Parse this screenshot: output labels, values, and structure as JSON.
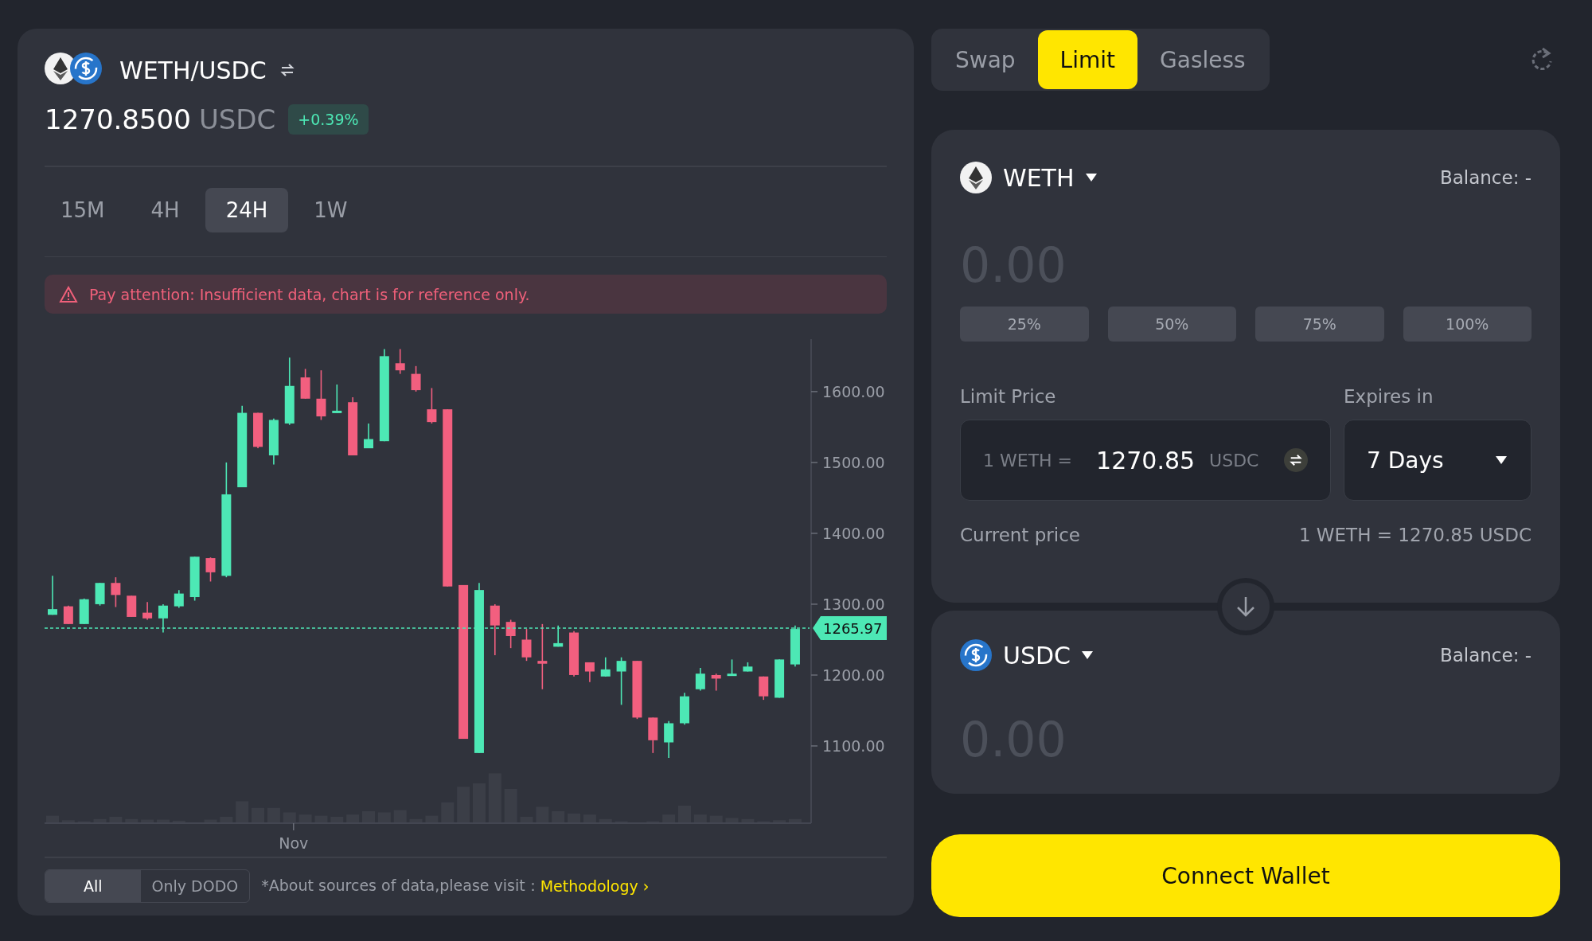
{
  "pair": {
    "title": "WETH/USDC",
    "price": "1270.8500",
    "quote": "USDC",
    "change": "+0.39%"
  },
  "timeframes": [
    {
      "label": "15M",
      "selected": false
    },
    {
      "label": "4H",
      "selected": false
    },
    {
      "label": "24H",
      "selected": true
    },
    {
      "label": "1W",
      "selected": false
    }
  ],
  "alert": "Pay attention: Insufficient data, chart is for reference only.",
  "chart": {
    "x_axis_label": "Nov",
    "last_price": "1265.97",
    "chart_data": {
      "type": "candlestick",
      "ylim": [
        991,
        1674
      ],
      "ohlc": [
        [
          1285,
          1340,
          1285,
          1293
        ],
        [
          1297,
          1298,
          1272,
          1272
        ],
        [
          1272,
          1308,
          1272,
          1307
        ],
        [
          1300,
          1330,
          1298,
          1330
        ],
        [
          1330,
          1338,
          1296,
          1313
        ],
        [
          1312,
          1312,
          1282,
          1282
        ],
        [
          1288,
          1303,
          1278,
          1280
        ],
        [
          1280,
          1300,
          1260,
          1298
        ],
        [
          1297,
          1320,
          1295,
          1315
        ],
        [
          1310,
          1367,
          1305,
          1367
        ],
        [
          1365,
          1366,
          1332,
          1345
        ],
        [
          1340,
          1500,
          1338,
          1455
        ],
        [
          1465,
          1580,
          1465,
          1570
        ],
        [
          1570,
          1570,
          1520,
          1522
        ],
        [
          1510,
          1562,
          1497,
          1560
        ],
        [
          1555,
          1648,
          1553,
          1608
        ],
        [
          1620,
          1632,
          1590,
          1590
        ],
        [
          1590,
          1630,
          1560,
          1565
        ],
        [
          1570,
          1610,
          1570,
          1573
        ],
        [
          1585,
          1592,
          1510,
          1510
        ],
        [
          1520,
          1555,
          1520,
          1533
        ],
        [
          1530,
          1660,
          1530,
          1650
        ],
        [
          1640,
          1660,
          1625,
          1630
        ],
        [
          1625,
          1636,
          1600,
          1602
        ],
        [
          1575,
          1605,
          1555,
          1557
        ],
        [
          1575,
          1575,
          1325,
          1325
        ],
        [
          1327,
          1327,
          1110,
          1110
        ],
        [
          1090,
          1330,
          1090,
          1320
        ],
        [
          1298,
          1300,
          1228,
          1270
        ],
        [
          1275,
          1278,
          1238,
          1255
        ],
        [
          1250,
          1265,
          1220,
          1225
        ],
        [
          1220,
          1272,
          1180,
          1216
        ],
        [
          1240,
          1270,
          1240,
          1245
        ],
        [
          1260,
          1262,
          1198,
          1200
        ],
        [
          1218,
          1218,
          1190,
          1205
        ],
        [
          1198,
          1225,
          1198,
          1208
        ],
        [
          1205,
          1225,
          1158,
          1220
        ],
        [
          1220,
          1220,
          1138,
          1140
        ],
        [
          1140,
          1140,
          1090,
          1108
        ],
        [
          1105,
          1135,
          1083,
          1132
        ],
        [
          1132,
          1175,
          1130,
          1170
        ],
        [
          1180,
          1210,
          1178,
          1202
        ],
        [
          1200,
          1202,
          1178,
          1195
        ],
        [
          1200,
          1222,
          1200,
          1202
        ],
        [
          1205,
          1218,
          1205,
          1212
        ],
        [
          1198,
          1198,
          1165,
          1170
        ],
        [
          1168,
          1222,
          1168,
          1222
        ],
        [
          1215,
          1270,
          1212,
          1265
        ]
      ],
      "yticks": [
        {
          "value": 1600,
          "label": "1600.00"
        },
        {
          "value": 1500,
          "label": "1500.00"
        },
        {
          "value": 1400,
          "label": "1400.00"
        },
        {
          "value": 1300,
          "label": "1300.00"
        },
        {
          "value": 1200,
          "label": "1200.00"
        },
        {
          "value": 1100,
          "label": "1100.00"
        }
      ]
    }
  },
  "source_filter": [
    {
      "label": "All",
      "selected": true
    },
    {
      "label": "Only DODO",
      "selected": false
    }
  ],
  "source_note": "*About sources of data,please visit：",
  "source_link": "Methodology ›",
  "trade_tabs": [
    {
      "label": "Swap",
      "selected": false
    },
    {
      "label": "Limit",
      "selected": true
    },
    {
      "label": "Gasless",
      "selected": false
    }
  ],
  "pay": {
    "token": "WETH",
    "balance": "Balance: -",
    "amount_placeholder": "0.00"
  },
  "percent_buttons": [
    "25%",
    "50%",
    "75%",
    "100%"
  ],
  "limit_price": {
    "label": "Limit Price",
    "prefix": "1 WETH =",
    "value": "1270.85",
    "unit": "USDC"
  },
  "expires": {
    "label": "Expires in",
    "value": "7 Days"
  },
  "current_price": {
    "label": "Current price",
    "value": "1 WETH = 1270.85 USDC"
  },
  "receive": {
    "token": "USDC",
    "balance": "Balance: -",
    "amount_placeholder": "0.00"
  },
  "connect_button": "Connect Wallet"
}
